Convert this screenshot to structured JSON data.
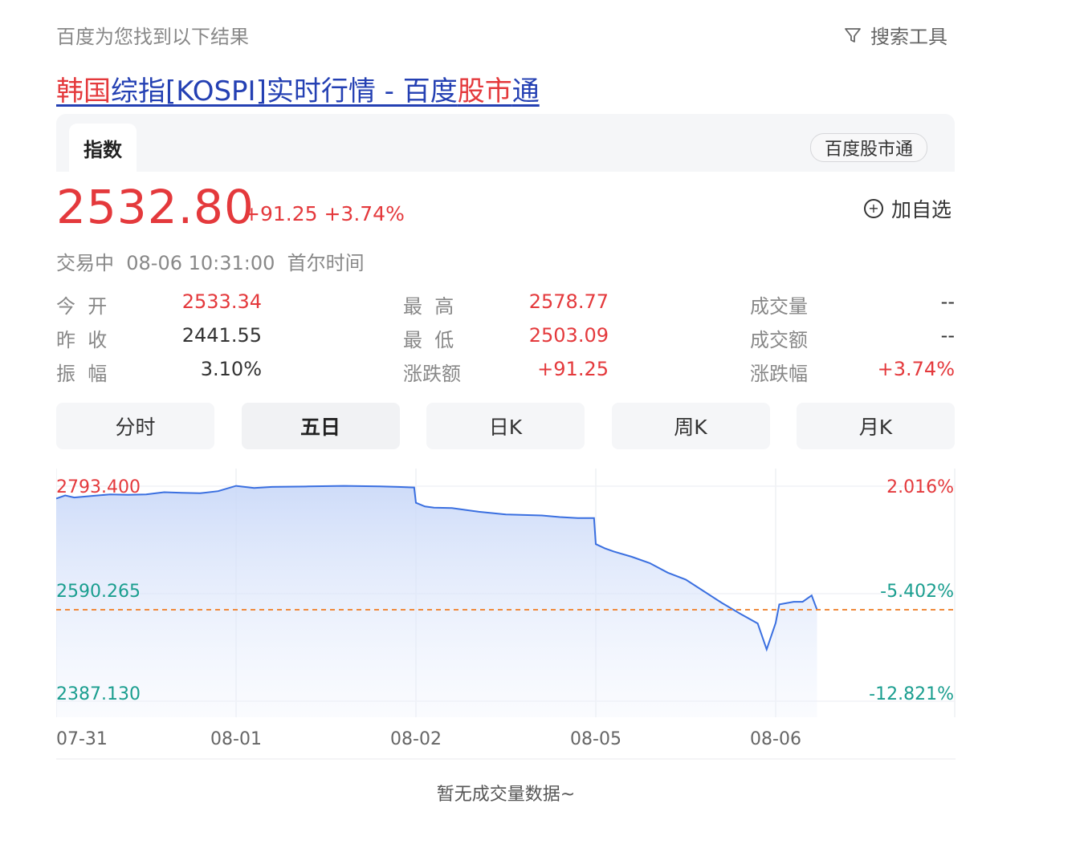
{
  "header": {
    "result_note": "百度为您找到以下结果",
    "search_tools": "搜索工具"
  },
  "result_title": {
    "part1": "韩国",
    "part2": "综指[KOSPI]实时行情 - 百度",
    "part3": "股市",
    "part4": "通"
  },
  "card": {
    "tab_label": "指数",
    "brand": "百度股市通",
    "add_watch": "加自选"
  },
  "quote": {
    "price": "2532.80",
    "change": "+91.25 +3.74%",
    "status": "交易中  08-06 10:31:00  首尔时间"
  },
  "stats": {
    "col1": [
      {
        "label": "今  开",
        "value": "2533.34"
      },
      {
        "label": "昨  收",
        "value": "2441.55"
      },
      {
        "label": "振  幅",
        "value": "3.10%"
      }
    ],
    "col2": [
      {
        "label": "最  高",
        "value": "2578.77"
      },
      {
        "label": "最  低",
        "value": "2503.09"
      },
      {
        "label": "涨跌额",
        "value": "+91.25"
      }
    ],
    "col3": [
      {
        "label": "成交量",
        "value": "--"
      },
      {
        "label": "成交额",
        "value": "--"
      },
      {
        "label": "涨跌幅",
        "value": "+3.74%"
      }
    ]
  },
  "periods": [
    "分时",
    "五日",
    "日K",
    "周K",
    "月K"
  ],
  "active_period": "五日",
  "colors": {
    "up": "#e4393c",
    "down": "#1a9e8f",
    "line": "#3a6fe0",
    "prev_close_line": "#f08a3c",
    "link": "#2440b3"
  },
  "chart_data": {
    "type": "line",
    "title": "",
    "xlabel": "",
    "ylabel": "",
    "ylim": [
      2387.13,
      2793.4
    ],
    "categories": [
      "07-31",
      "08-01",
      "08-02",
      "08-05",
      "08-06"
    ],
    "y_ticks_left": [
      "2793.400",
      "2590.265",
      "2387.130"
    ],
    "y_ticks_right": [
      "2.016%",
      "-5.402%",
      "-12.821%"
    ],
    "reference_line": {
      "name": "prev_close",
      "value": 2560
    },
    "series": [
      {
        "x": [
          0,
          0.05,
          0.1,
          0.2,
          0.3,
          0.4,
          0.5,
          0.6,
          0.7,
          0.8,
          0.9,
          1.0,
          1.1,
          1.2,
          1.4,
          1.6,
          1.8,
          1.9,
          1.99,
          2.0,
          2.05,
          2.1,
          2.2,
          2.35,
          2.5,
          2.7,
          2.8,
          2.9,
          2.99,
          3.0,
          3.05,
          3.1,
          3.2,
          3.3,
          3.4,
          3.5,
          3.6,
          3.7,
          3.8,
          3.9,
          3.95,
          4.0,
          4.02,
          4.1,
          4.15,
          4.2,
          4.23
        ],
        "values": [
          2770,
          2776,
          2772,
          2775,
          2778,
          2777,
          2778,
          2782,
          2781,
          2780,
          2784,
          2794,
          2790,
          2792,
          2793,
          2794,
          2793,
          2792,
          2791,
          2762,
          2755,
          2753,
          2752,
          2745,
          2740,
          2738,
          2735,
          2733,
          2733,
          2684,
          2676,
          2670,
          2660,
          2648,
          2630,
          2617,
          2595,
          2573,
          2553,
          2534,
          2485,
          2535,
          2570,
          2575,
          2575,
          2587,
          2560
        ]
      }
    ]
  },
  "volume_note": "暂无成交量数据~"
}
